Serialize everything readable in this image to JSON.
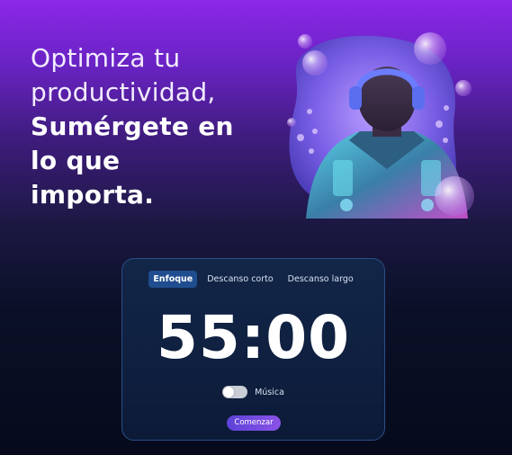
{
  "hero": {
    "line1": "Optimiza tu",
    "line2": "productividad,",
    "line3": "Sumérgete en",
    "line4": "lo que",
    "line5": "importa."
  },
  "timer": {
    "tabs": [
      {
        "label": "Enfoque",
        "active": true
      },
      {
        "label": "Descanso corto",
        "active": false
      },
      {
        "label": "Descanso largo",
        "active": false
      }
    ],
    "display": "55:00",
    "music_label": "Música",
    "music_enabled": false,
    "start_label": "Comenzar"
  },
  "colors": {
    "accent": "#8a52e6",
    "tab_active": "#1f4d8f",
    "card_border": "#2c4e86"
  },
  "icons": {
    "illustration": "person-with-headphones-illustration",
    "bubbles": "bubble-icon"
  }
}
